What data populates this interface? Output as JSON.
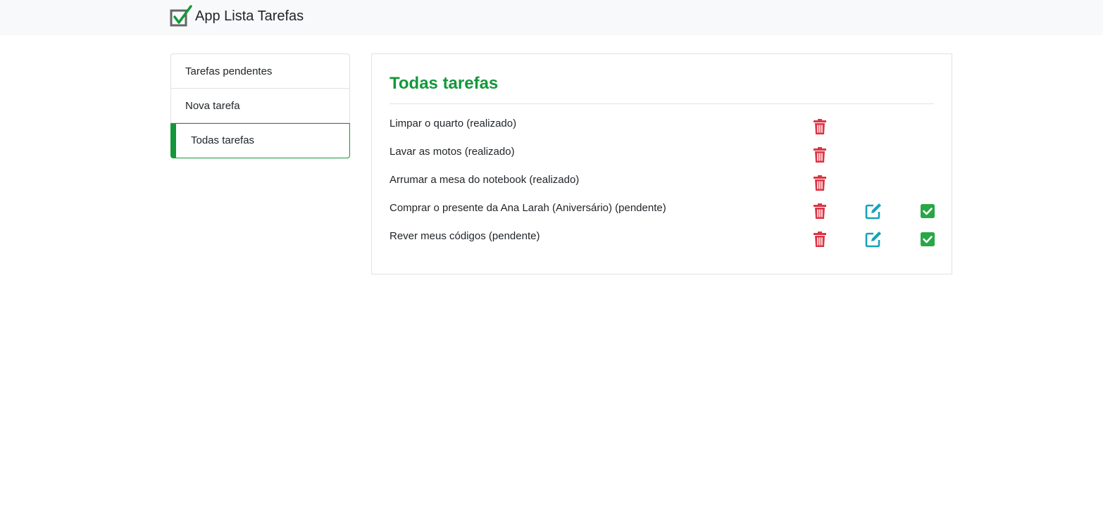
{
  "app": {
    "title": "App Lista Tarefas",
    "logo_icon": "checkbox-check-icon"
  },
  "sidebar": {
    "items": [
      {
        "label": "Tarefas pendentes",
        "active": false
      },
      {
        "label": "Nova tarefa",
        "active": false
      },
      {
        "label": "Todas tarefas",
        "active": true
      }
    ]
  },
  "main": {
    "title": "Todas tarefas",
    "tasks": [
      {
        "text": "Limpar o quarto (realizado)",
        "actions": [
          "delete"
        ]
      },
      {
        "text": "Lavar as motos (realizado)",
        "actions": [
          "delete"
        ]
      },
      {
        "text": "Arrumar a mesa do notebook (realizado)",
        "actions": [
          "delete"
        ]
      },
      {
        "text": "Comprar o presente da Ana Larah (Aniversário) (pendente)",
        "actions": [
          "delete",
          "edit",
          "complete"
        ]
      },
      {
        "text": "Rever meus códigos (pendente)",
        "actions": [
          "delete",
          "edit",
          "complete"
        ]
      }
    ]
  },
  "icons": {
    "delete": "trash-icon",
    "edit": "edit-icon",
    "complete": "check-square-icon"
  },
  "colors": {
    "accent": "#14973b",
    "danger": "#dc3545",
    "info": "#17a2b8",
    "success": "#28a745",
    "navbar": "#f8f9fa"
  }
}
